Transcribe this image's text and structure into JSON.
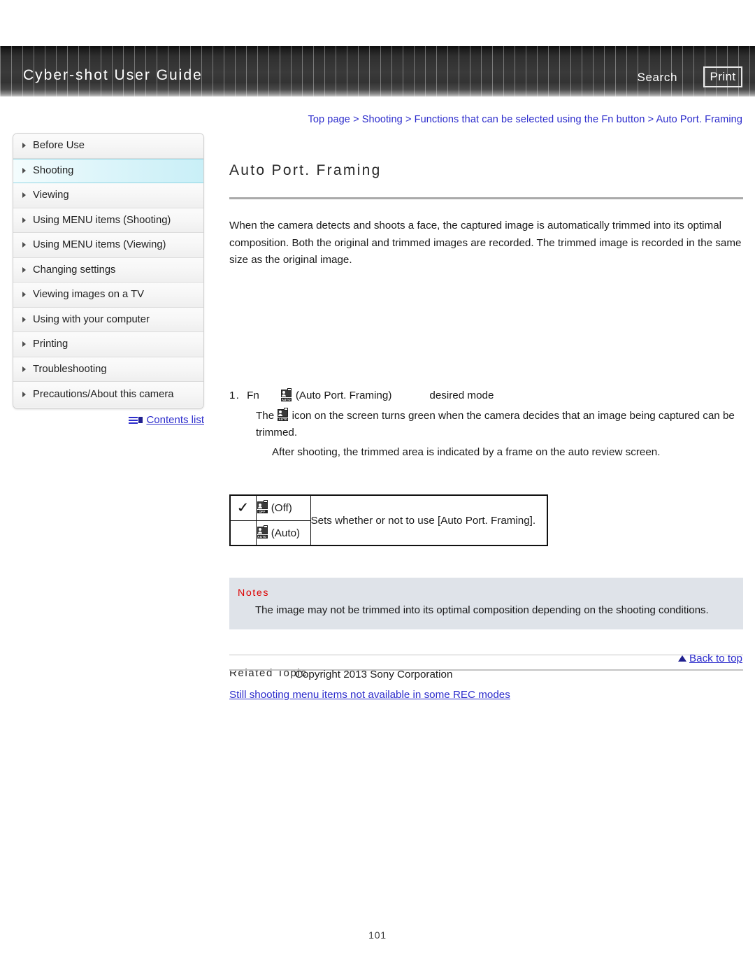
{
  "header": {
    "title": "Cyber-shot User Guide",
    "search_label": "Search",
    "print_label": "Print"
  },
  "breadcrumb": {
    "text": "Top page > Shooting > Functions that can be selected using the Fn button > Auto Port. Framing"
  },
  "sidebar": {
    "items": [
      {
        "label": "Before Use",
        "selected": false
      },
      {
        "label": "Shooting",
        "selected": true
      },
      {
        "label": "Viewing",
        "selected": false
      },
      {
        "label": "Using MENU items (Shooting)",
        "selected": false
      },
      {
        "label": "Using MENU items (Viewing)",
        "selected": false
      },
      {
        "label": "Changing settings",
        "selected": false
      },
      {
        "label": "Viewing images on a TV",
        "selected": false
      },
      {
        "label": "Using with your computer",
        "selected": false
      },
      {
        "label": "Printing",
        "selected": false
      },
      {
        "label": "Troubleshooting",
        "selected": false
      },
      {
        "label": "Precautions/About this camera",
        "selected": false
      }
    ],
    "contents_link": "Contents list"
  },
  "main": {
    "title": "Auto Port. Framing",
    "intro": "When the camera detects and shoots a face, the captured image is automatically trimmed into its optimal composition. Both the original and trimmed images are recorded. The trimmed image is recorded in the same size as the original image.",
    "step": {
      "number": "1.",
      "fn_label": "Fn",
      "icon_name": "auto-port-framing-auto-icon",
      "icon_caption": "(Auto Port. Framing)",
      "mode_label": "desired mode",
      "body_prefix": "The",
      "body_suffix": "icon on the screen turns green when the camera decides that an image being captured can be trimmed.",
      "sub_note": "After shooting, the trimmed area is indicated by a frame on the auto review screen."
    },
    "settings_table": {
      "rows": [
        {
          "checked": true,
          "icon_label": "OFF",
          "option": "(Off)"
        },
        {
          "checked": false,
          "icon_label": "AUTO",
          "option": "(Auto)"
        }
      ],
      "description": "Sets whether or not to use [Auto Port. Framing]."
    },
    "notes": {
      "title": "Notes",
      "body": "The image may not be trimmed into its optimal composition depending on the shooting conditions."
    },
    "related": {
      "title": "Related Topic",
      "link": "Still shooting menu items not available in some REC modes"
    }
  },
  "footer": {
    "back_to_top": "Back to top",
    "copyright": "Copyright 2013 Sony Corporation",
    "page_number": "101"
  },
  "colors": {
    "link": "#2c2ccc",
    "notes_title": "#dd0000",
    "notes_bg": "#dfe3e9",
    "selected_item": "#c9eff7"
  }
}
